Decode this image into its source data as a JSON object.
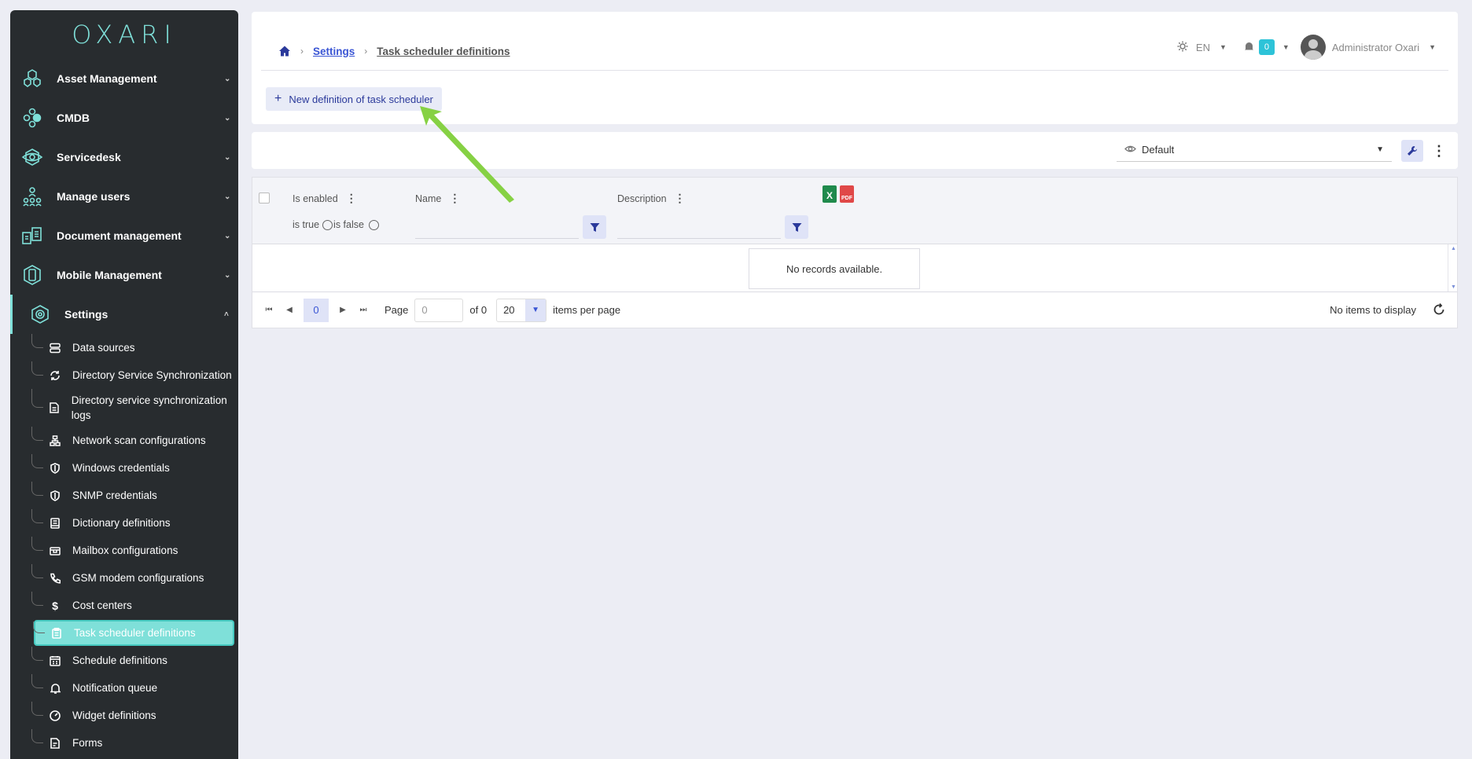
{
  "brand": {
    "logo_text": "OXARI",
    "accent": "#7fe0d9"
  },
  "sidebar": {
    "modules": [
      {
        "label": "Asset Management",
        "icon": "asset-hexagon-icon"
      },
      {
        "label": "CMDB",
        "icon": "cmdb-nodes-icon"
      },
      {
        "label": "Servicedesk",
        "icon": "servicedesk-eye-icon"
      },
      {
        "label": "Manage users",
        "icon": "users-tree-icon"
      },
      {
        "label": "Document management",
        "icon": "documents-icon"
      },
      {
        "label": "Mobile Management",
        "icon": "mobile-hexagon-icon"
      }
    ],
    "settings": {
      "label": "Settings",
      "icon": "settings-gear-icon"
    },
    "items": [
      {
        "label": "Data sources",
        "icon": "database-icon"
      },
      {
        "label": "Directory Service Synchronization",
        "icon": "sync-icon"
      },
      {
        "label": "Directory service synchronization logs",
        "icon": "file-log-icon"
      },
      {
        "label": "Network scan configurations",
        "icon": "network-icon"
      },
      {
        "label": "Windows credentials",
        "icon": "shield-icon"
      },
      {
        "label": "SNMP credentials",
        "icon": "shield-icon"
      },
      {
        "label": "Dictionary definitions",
        "icon": "book-icon"
      },
      {
        "label": "Mailbox configurations",
        "icon": "mailbox-icon"
      },
      {
        "label": "GSM modem configurations",
        "icon": "phone-icon"
      },
      {
        "label": "Cost centers",
        "icon": "dollar-icon"
      },
      {
        "label": "Task scheduler definitions",
        "icon": "clipboard-icon",
        "active": true
      },
      {
        "label": "Schedule definitions",
        "icon": "calendar-icon"
      },
      {
        "label": "Notification queue",
        "icon": "bell-icon"
      },
      {
        "label": "Widget definitions",
        "icon": "gauge-icon"
      },
      {
        "label": "Forms",
        "icon": "form-icon"
      }
    ]
  },
  "header": {
    "breadcrumb": [
      "Settings",
      "Task scheduler definitions"
    ],
    "language": "EN",
    "notification_count": "0",
    "user_name": "Administrator Oxari"
  },
  "toolbar": {
    "new_button": "New definition of task scheduler"
  },
  "view": {
    "selected": "Default"
  },
  "grid": {
    "columns": [
      "Is enabled",
      "Name",
      "Description"
    ],
    "filter_true": "is true",
    "filter_false": "is false",
    "empty_message": "No records available."
  },
  "pager": {
    "current_page": "0",
    "page_label": "Page",
    "page_input": "0",
    "of_label": "of 0",
    "page_size": "20",
    "items_per_page": "items per page",
    "status": "No items to display"
  }
}
